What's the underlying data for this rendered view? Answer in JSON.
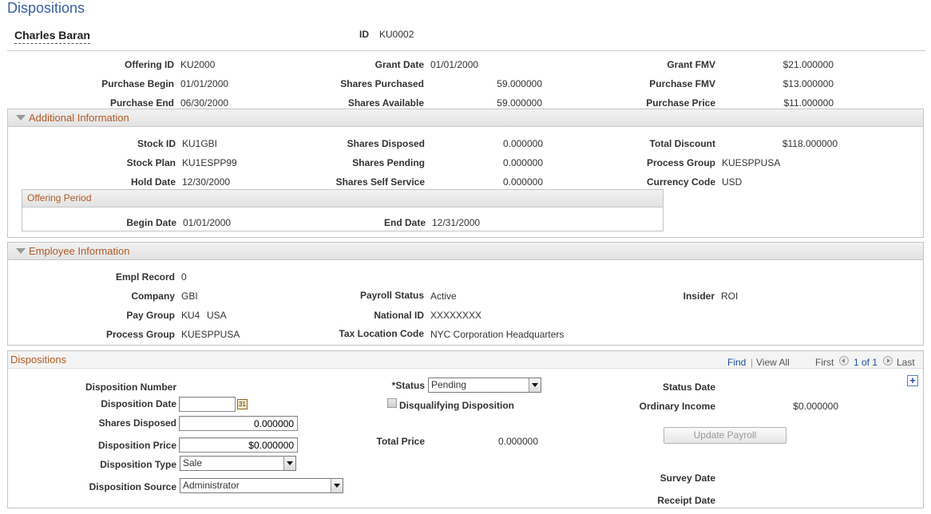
{
  "page_title": "Dispositions",
  "employee": {
    "name": "Charles Baran",
    "id_label": "ID",
    "id_value": "KU0002"
  },
  "offering": {
    "offering_id_label": "Offering ID",
    "offering_id": "KU2000",
    "purchase_begin_label": "Purchase Begin",
    "purchase_begin": "01/01/2000",
    "purchase_end_label": "Purchase End",
    "purchase_end": "06/30/2000",
    "grant_date_label": "Grant Date",
    "grant_date": "01/01/2000",
    "shares_purchased_label": "Shares Purchased",
    "shares_purchased": "59.000000",
    "shares_available_label": "Shares Available",
    "shares_available": "59.000000",
    "grant_fmv_label": "Grant FMV",
    "grant_fmv": "$21.000000",
    "purchase_fmv_label": "Purchase FMV",
    "purchase_fmv": "$13.000000",
    "purchase_price_label": "Purchase Price",
    "purchase_price": "$11.000000"
  },
  "additional": {
    "title": "Additional Information",
    "stock_id_label": "Stock ID",
    "stock_id": "KU1GBI",
    "stock_plan_label": "Stock Plan",
    "stock_plan": "KU1ESPP99",
    "hold_date_label": "Hold Date",
    "hold_date": "12/30/2000",
    "shares_disposed_label": "Shares Disposed",
    "shares_disposed": "0.000000",
    "shares_pending_label": "Shares Pending",
    "shares_pending": "0.000000",
    "shares_self_service_label": "Shares Self Service",
    "shares_self_service": "0.000000",
    "total_discount_label": "Total Discount",
    "total_discount": "$118.000000",
    "process_group_label": "Process Group",
    "process_group": "KUESPPUSA",
    "currency_code_label": "Currency Code",
    "currency_code": "USD",
    "offering_period": {
      "title": "Offering Period",
      "begin_date_label": "Begin Date",
      "begin_date": "01/01/2000",
      "end_date_label": "End Date",
      "end_date": "12/31/2000"
    }
  },
  "employee_info": {
    "title": "Employee Information",
    "empl_record_label": "Empl Record",
    "empl_record": "0",
    "company_label": "Company",
    "company": "GBI",
    "pay_group_label": "Pay Group",
    "pay_group": "KU4",
    "pay_group_country": "USA",
    "process_group_label": "Process Group",
    "process_group": "KUESPPUSA",
    "payroll_status_label": "Payroll Status",
    "payroll_status": "Active",
    "national_id_label": "National ID",
    "national_id": "XXXXXXXX",
    "tax_location_label": "Tax Location Code",
    "tax_location": "NYC Corporation Headquarters",
    "insider_label": "Insider",
    "insider": "ROI"
  },
  "dispositions": {
    "title": "Dispositions",
    "nav": {
      "find": "Find",
      "separator": "|",
      "view_all": "View All",
      "first": "First",
      "range": "1 of 1",
      "last": "Last"
    },
    "disposition_number_label": "Disposition Number",
    "disposition_date_label": "Disposition Date",
    "disposition_date": "",
    "shares_disposed_label": "Shares Disposed",
    "shares_disposed": "0.000000",
    "disposition_price_label": "Disposition Price",
    "disposition_price": "$0.000000",
    "disposition_type_label": "Disposition Type",
    "disposition_type": "Sale",
    "disposition_source_label": "Disposition Source",
    "disposition_source": "Administrator",
    "status_label": "*Status",
    "status": "Pending",
    "disqualifying_label": "Disqualifying Disposition",
    "total_price_label": "Total Price",
    "total_price": "0.000000",
    "status_date_label": "Status Date",
    "ordinary_income_label": "Ordinary Income",
    "ordinary_income": "$0.000000",
    "update_payroll": "Update Payroll",
    "survey_date_label": "Survey Date",
    "receipt_date_label": "Receipt Date",
    "add_row": "+",
    "calendar_glyph": "31"
  },
  "icons": {
    "collapse": "triangle-down-icon",
    "calendar": "calendar-icon",
    "add": "plus-icon"
  },
  "colors": {
    "title": "#3a5fa0",
    "section_title": "#b05a26",
    "link": "#1d4f9c"
  }
}
